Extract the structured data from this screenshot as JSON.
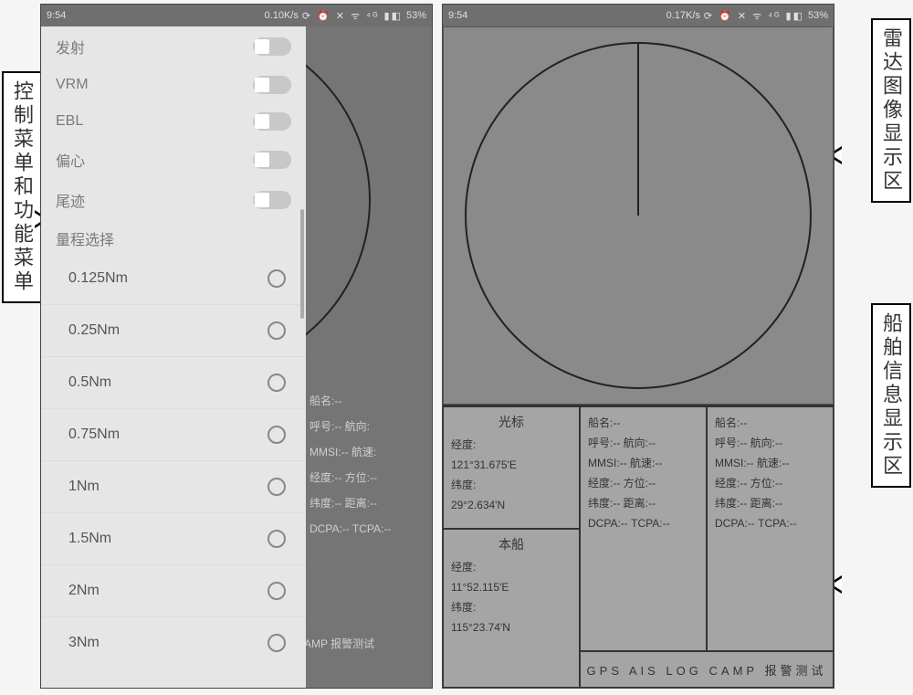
{
  "statusbar": {
    "time": "9:54",
    "speed_left": "0.10K/s",
    "speed_right": "0.17K/s",
    "icons": "⟳ ⏰ ✕ ᯤ ⁴ᴳ ▮◧",
    "battery": "53%"
  },
  "annotations": {
    "left": "控制菜单和功能菜单",
    "right_top": "雷达图像显示区",
    "right_bottom": "船舶信息显示区"
  },
  "menu": {
    "toggles": [
      {
        "label": "发射"
      },
      {
        "label": "VRM"
      },
      {
        "label": "EBL"
      },
      {
        "label": "偏心"
      },
      {
        "label": "尾迹"
      }
    ],
    "range_label": "量程选择",
    "ranges": [
      "0.125Nm",
      "0.25Nm",
      "0.5Nm",
      "0.75Nm",
      "1Nm",
      "1.5Nm",
      "2Nm",
      "3Nm"
    ]
  },
  "fragments": {
    "behind": [
      "船名:--",
      "呼号:-- 航向:",
      "MMSI:-- 航速:",
      "经度:-- 方位:--",
      "纬度:-- 距离:--",
      "DCPA:-- TCPA:--"
    ],
    "bottom": "AMP 报警测试"
  },
  "info": {
    "cursor": {
      "title": "光标",
      "lon_label": "经度:",
      "lon_val": "121°31.675'E",
      "lat_label": "纬度:",
      "lat_val": "29°2.634'N"
    },
    "own": {
      "title": "本船",
      "lon_label": "经度:",
      "lon_val": "11°52.115'E",
      "lat_label": "纬度:",
      "lat_val": "115°23.74'N"
    },
    "ais": {
      "name_label": "船名:--",
      "call_label": "呼号:--",
      "hdg_label": "航向:--",
      "mmsi_label": "MMSI:--",
      "spd_label": "航速:--",
      "lon_label": "经度:--",
      "brg_label": "方位:--",
      "lat_label": "纬度:--",
      "dist_label": "距离:--",
      "dcpa_label": "DCPA:--",
      "tcpa_label": "TCPA:--"
    },
    "buttons": "GPS AIS LOG CAMP 报警测试"
  }
}
